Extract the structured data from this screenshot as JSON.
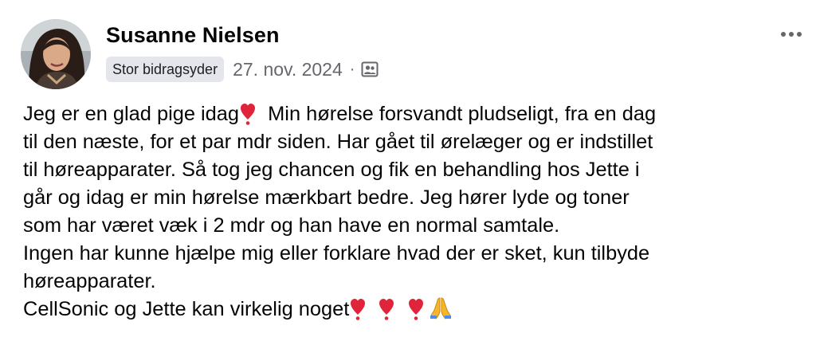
{
  "post": {
    "author": {
      "name": "Susanne Nielsen",
      "badge": "Stor bidragsyder"
    },
    "date": "27. nov. 2024",
    "separator": "·",
    "privacy_icon": "group-icon",
    "menu_icon": "more-icon",
    "colors": {
      "text": "#050505",
      "secondary_text": "#65676b",
      "badge_background": "#e4e6eb",
      "heart": "#e0243a",
      "hands": "#f7b529"
    },
    "body": {
      "line1_a": "Jeg er en glad pige idag",
      "line1_b": "Min hørelse forsvandt pludseligt, fra en dag",
      "line2": "til den næste, for et par mdr siden. Har gået til ørelæger og er indstillet",
      "line3": "til høreapparater. Så tog jeg chancen og fik en behandling hos Jette i",
      "line4": "går og idag er min hørelse mærkbart bedre. Jeg hører lyde og toner",
      "line5": "som har været væk i 2 mdr og han have en normal samtale.",
      "line6": "Ingen har kunne hjælpe mig eller forklare hvad der er sket, kun tilbyde",
      "line7": "høreapparater.",
      "line8": "CellSonic og Jette kan virkelig noget"
    }
  }
}
